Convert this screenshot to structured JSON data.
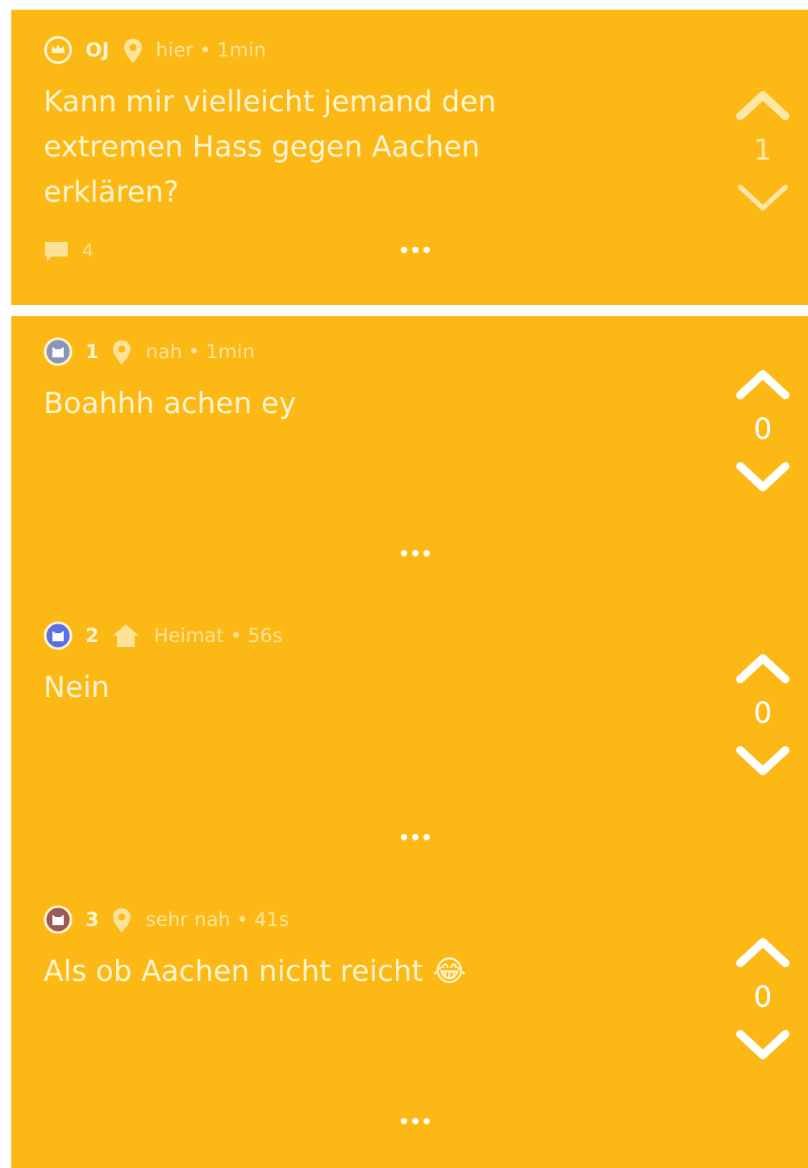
{
  "post": {
    "author": "OJ",
    "badge": {
      "kind": "op"
    },
    "place": {
      "kind": "pin",
      "text": "hier"
    },
    "separator": "•",
    "time": "1min",
    "text": "Kann mir vielleicht jemand den extremen Hass gegen Aachen erklären?",
    "comment_count": "4",
    "votes": "1",
    "voting_disabled": true,
    "more": "•••"
  },
  "comments": [
    {
      "author": "1",
      "color": "#8a95b8",
      "place": {
        "kind": "pin",
        "text": "nah"
      },
      "separator": "•",
      "time": "1min",
      "text": "Boahhh achen ey",
      "votes": "0",
      "voting_disabled": false,
      "more": "•••"
    },
    {
      "author": "2",
      "color": "#5b6fe6",
      "place": {
        "kind": "home",
        "text": "Heimat"
      },
      "separator": "•",
      "time": "56s",
      "text": "Nein",
      "votes": "0",
      "voting_disabled": false,
      "more": "•••"
    },
    {
      "author": "3",
      "color": "#9c5a55",
      "place": {
        "kind": "pin",
        "text": "sehr nah"
      },
      "separator": "•",
      "time": "41s",
      "text": "Als ob Aachen nicht reicht 😂",
      "votes": "0",
      "voting_disabled": false,
      "more": "•••"
    }
  ]
}
